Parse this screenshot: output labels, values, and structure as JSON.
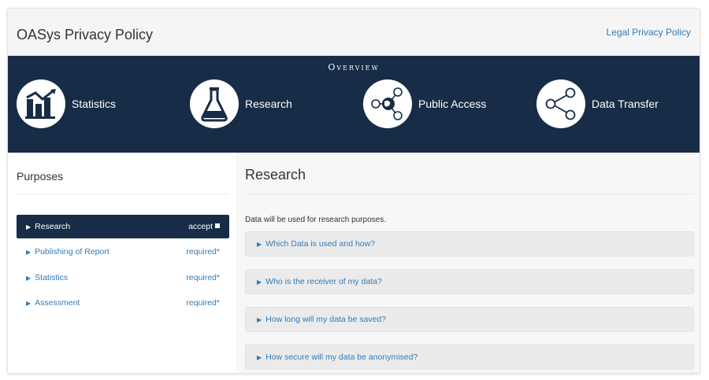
{
  "header": {
    "title": "OASys Privacy Policy",
    "legal_link": "Legal Privacy Policy"
  },
  "overview": {
    "title": "Overview",
    "items": [
      {
        "label": "Statistics",
        "icon": "chart-icon"
      },
      {
        "label": "Research",
        "icon": "flask-icon"
      },
      {
        "label": "Public Access",
        "icon": "globe-share-icon"
      },
      {
        "label": "Data Transfer",
        "icon": "share-icon"
      }
    ]
  },
  "sidebar": {
    "title": "Purposes",
    "items": [
      {
        "name": "Research",
        "status": "accept",
        "active": true
      },
      {
        "name": "Publishing of Report",
        "status": "required*",
        "active": false
      },
      {
        "name": "Statistics",
        "status": "required*",
        "active": false
      },
      {
        "name": "Assessment",
        "status": "required*",
        "active": false
      }
    ]
  },
  "main": {
    "title": "Research",
    "description": "Data will be used for research purposes.",
    "questions": [
      "Which Data is used and how?",
      "Who is the receiver of my data?",
      "How long will my data be saved?",
      "How secure will my data be anonymised?"
    ]
  },
  "colors": {
    "navy": "#172c46",
    "link": "#337ab7",
    "panel": "#f7f7f7"
  }
}
